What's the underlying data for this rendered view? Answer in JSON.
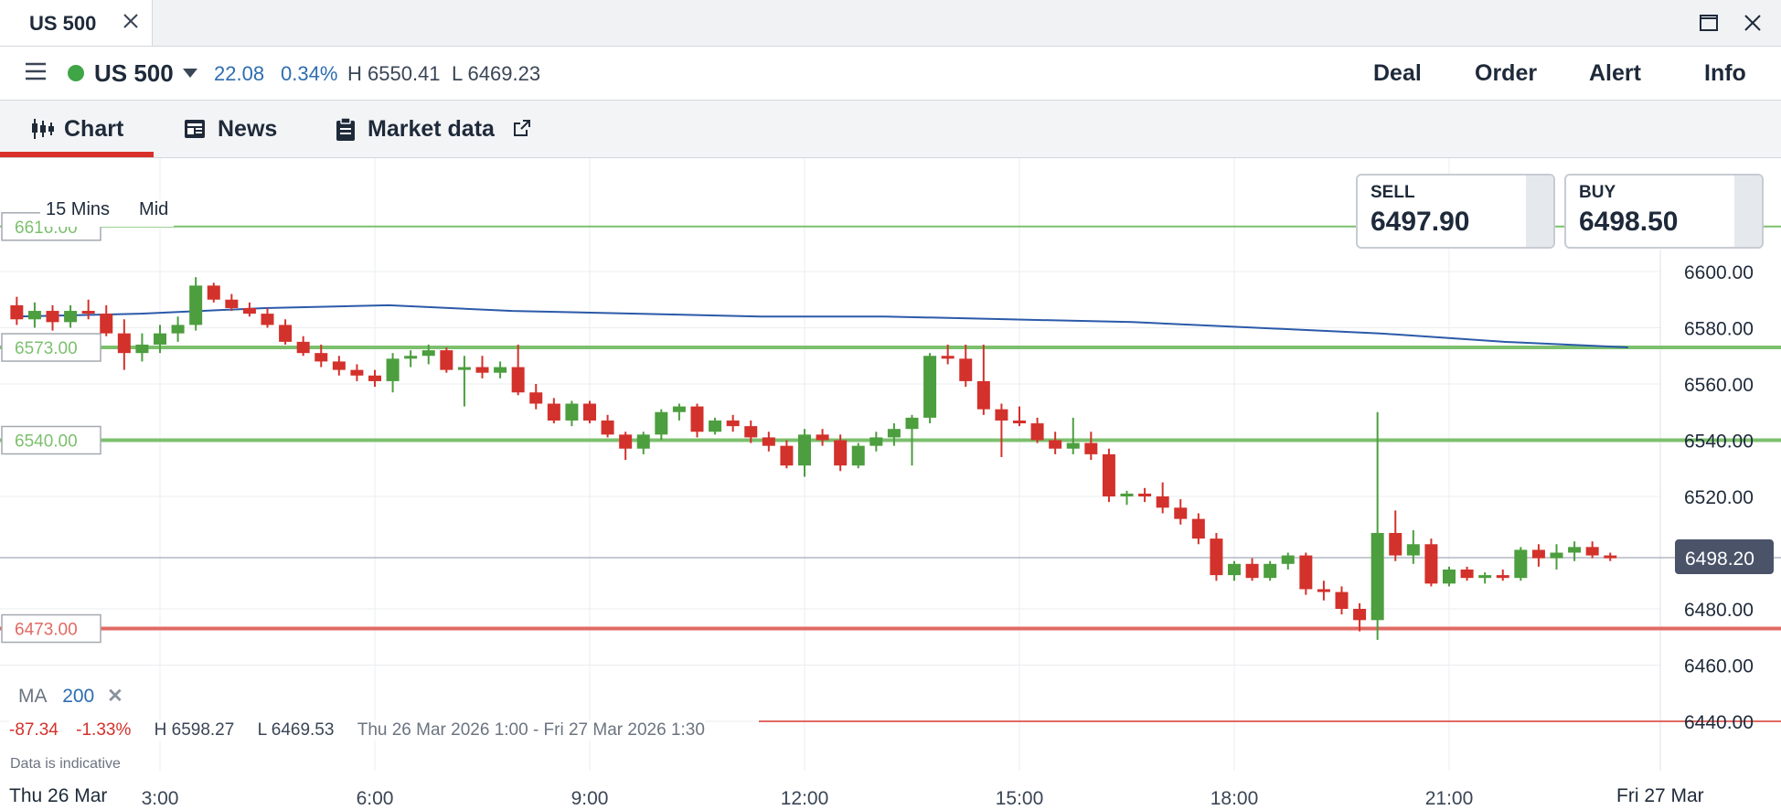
{
  "window": {
    "tab_title": "US 500"
  },
  "instrument": {
    "name": "US 500",
    "change": "22.08",
    "change_pct": "0.34%",
    "high": "H 6550.41",
    "low": "L 6469.23",
    "status_color": "#3fa546"
  },
  "actions": [
    "Deal",
    "Order",
    "Alert",
    "Info"
  ],
  "subtabs": [
    {
      "label": "Chart",
      "icon": "candlestick-icon",
      "active": true
    },
    {
      "label": "News",
      "icon": "newspaper-icon",
      "active": false
    },
    {
      "label": "Market data",
      "icon": "clipboard-icon",
      "active": false
    }
  ],
  "chart": {
    "timeframe": "15 Mins",
    "price_type": "Mid",
    "sell": {
      "label": "SELL",
      "price": "6497.90"
    },
    "buy": {
      "label": "BUY",
      "price": "6498.50"
    },
    "ma": {
      "label": "MA",
      "period": "200",
      "color": "#2b5aa8"
    },
    "stats": {
      "change": "-87.34",
      "change_pct": "-1.33%",
      "high": "H 6598.27",
      "low": "L 6469.53",
      "range": "Thu 26 Mar 2026 1:00 - Fri 27 Mar 2026 1:30"
    },
    "disclaimer": "Data is indicative",
    "start_date": "Thu 26 Mar",
    "end_date": "Fri 27 Mar",
    "current_price": "6498.20",
    "colors": {
      "up": "#4c9e3e",
      "down": "#d3312b",
      "green_line": "#7cc06e",
      "red_line": "#e06a63"
    }
  },
  "chart_data": {
    "type": "candlestick",
    "y_ticks": [
      6600,
      6580,
      6560,
      6540,
      6520,
      6480,
      6460,
      6440
    ],
    "y_tick_labels": [
      "6600.00",
      "6580.00",
      "6560.00",
      "6540.00",
      "6520.00",
      "6480.00",
      "6460.00",
      "6440.00"
    ],
    "ylim": [
      6424,
      6645
    ],
    "x_ticks": [
      "3:00",
      "6:00",
      "9:00",
      "12:00",
      "15:00",
      "18:00",
      "21:00"
    ],
    "level_lines": [
      {
        "price": 6573.0,
        "label": "6573.00",
        "color": "green"
      },
      {
        "price": 6540.0,
        "label": "6540.00",
        "color": "green"
      },
      {
        "price": 6473.0,
        "label": "6473.00",
        "color": "red"
      },
      {
        "price": 6440.0,
        "label": "6440.00",
        "color": "red"
      },
      {
        "price": 6616.0,
        "label": "6616.00",
        "color": "green"
      }
    ],
    "current_price": 6498.2,
    "candles": [
      {
        "t": "1:00",
        "o": 6588,
        "h": 6591,
        "l": 6581,
        "c": 6583
      },
      {
        "t": "1:15",
        "o": 6583,
        "h": 6589,
        "l": 6580,
        "c": 6586
      },
      {
        "t": "1:30",
        "o": 6586,
        "h": 6588,
        "l": 6579,
        "c": 6582
      },
      {
        "t": "1:45",
        "o": 6582,
        "h": 6588,
        "l": 6580,
        "c": 6586
      },
      {
        "t": "2:00",
        "o": 6586,
        "h": 6590,
        "l": 6583,
        "c": 6585
      },
      {
        "t": "2:15",
        "o": 6585,
        "h": 6588,
        "l": 6577,
        "c": 6578
      },
      {
        "t": "2:30",
        "o": 6578,
        "h": 6583,
        "l": 6565,
        "c": 6571
      },
      {
        "t": "2:45",
        "o": 6571,
        "h": 6578,
        "l": 6568,
        "c": 6574
      },
      {
        "t": "3:00",
        "o": 6574,
        "h": 6581,
        "l": 6571,
        "c": 6578
      },
      {
        "t": "3:15",
        "o": 6578,
        "h": 6584,
        "l": 6575,
        "c": 6581
      },
      {
        "t": "3:30",
        "o": 6581,
        "h": 6598,
        "l": 6579,
        "c": 6595
      },
      {
        "t": "3:45",
        "o": 6595,
        "h": 6596,
        "l": 6589,
        "c": 6590
      },
      {
        "t": "4:00",
        "o": 6590,
        "h": 6592,
        "l": 6586,
        "c": 6587
      },
      {
        "t": "4:15",
        "o": 6587,
        "h": 6589,
        "l": 6584,
        "c": 6585
      },
      {
        "t": "4:30",
        "o": 6585,
        "h": 6587,
        "l": 6580,
        "c": 6581
      },
      {
        "t": "4:45",
        "o": 6581,
        "h": 6583,
        "l": 6574,
        "c": 6575
      },
      {
        "t": "5:00",
        "o": 6575,
        "h": 6577,
        "l": 6570,
        "c": 6571
      },
      {
        "t": "5:15",
        "o": 6571,
        "h": 6574,
        "l": 6566,
        "c": 6568
      },
      {
        "t": "5:30",
        "o": 6568,
        "h": 6570,
        "l": 6563,
        "c": 6565
      },
      {
        "t": "5:45",
        "o": 6565,
        "h": 6567,
        "l": 6561,
        "c": 6563
      },
      {
        "t": "6:00",
        "o": 6563,
        "h": 6565,
        "l": 6559,
        "c": 6561
      },
      {
        "t": "6:15",
        "o": 6561,
        "h": 6571,
        "l": 6557,
        "c": 6569
      },
      {
        "t": "6:30",
        "o": 6569,
        "h": 6572,
        "l": 6566,
        "c": 6570
      },
      {
        "t": "6:45",
        "o": 6570,
        "h": 6574,
        "l": 6567,
        "c": 6572
      },
      {
        "t": "7:00",
        "o": 6572,
        "h": 6573,
        "l": 6564,
        "c": 6565
      },
      {
        "t": "7:15",
        "o": 6565,
        "h": 6570,
        "l": 6552,
        "c": 6566
      },
      {
        "t": "7:30",
        "o": 6566,
        "h": 6570,
        "l": 6562,
        "c": 6564
      },
      {
        "t": "7:45",
        "o": 6564,
        "h": 6568,
        "l": 6562,
        "c": 6566
      },
      {
        "t": "8:00",
        "o": 6566,
        "h": 6574,
        "l": 6556,
        "c": 6557
      },
      {
        "t": "8:15",
        "o": 6557,
        "h": 6560,
        "l": 6551,
        "c": 6553
      },
      {
        "t": "8:30",
        "o": 6553,
        "h": 6555,
        "l": 6546,
        "c": 6547
      },
      {
        "t": "8:45",
        "o": 6547,
        "h": 6554,
        "l": 6545,
        "c": 6553
      },
      {
        "t": "9:00",
        "o": 6553,
        "h": 6554,
        "l": 6546,
        "c": 6547
      },
      {
        "t": "9:15",
        "o": 6547,
        "h": 6549,
        "l": 6541,
        "c": 6542
      },
      {
        "t": "9:30",
        "o": 6542,
        "h": 6543,
        "l": 6533,
        "c": 6537
      },
      {
        "t": "9:45",
        "o": 6537,
        "h": 6543,
        "l": 6535,
        "c": 6542
      },
      {
        "t": "10:00",
        "o": 6542,
        "h": 6551,
        "l": 6540,
        "c": 6550
      },
      {
        "t": "10:15",
        "o": 6550,
        "h": 6553,
        "l": 6547,
        "c": 6552
      },
      {
        "t": "10:30",
        "o": 6552,
        "h": 6553,
        "l": 6541,
        "c": 6543
      },
      {
        "t": "10:45",
        "o": 6543,
        "h": 6548,
        "l": 6542,
        "c": 6547
      },
      {
        "t": "11:00",
        "o": 6547,
        "h": 6549,
        "l": 6543,
        "c": 6545
      },
      {
        "t": "11:15",
        "o": 6545,
        "h": 6547,
        "l": 6539,
        "c": 6541
      },
      {
        "t": "11:30",
        "o": 6541,
        "h": 6543,
        "l": 6536,
        "c": 6538
      },
      {
        "t": "11:45",
        "o": 6538,
        "h": 6540,
        "l": 6530,
        "c": 6531
      },
      {
        "t": "12:00",
        "o": 6531,
        "h": 6544,
        "l": 6527,
        "c": 6542
      },
      {
        "t": "12:15",
        "o": 6542,
        "h": 6544,
        "l": 6538,
        "c": 6540
      },
      {
        "t": "12:30",
        "o": 6540,
        "h": 6542,
        "l": 6529,
        "c": 6531
      },
      {
        "t": "12:45",
        "o": 6531,
        "h": 6539,
        "l": 6530,
        "c": 6538
      },
      {
        "t": "13:00",
        "o": 6538,
        "h": 6543,
        "l": 6536,
        "c": 6541
      },
      {
        "t": "13:15",
        "o": 6541,
        "h": 6546,
        "l": 6538,
        "c": 6544
      },
      {
        "t": "13:30",
        "o": 6544,
        "h": 6549,
        "l": 6531,
        "c": 6548
      },
      {
        "t": "13:45",
        "o": 6548,
        "h": 6571,
        "l": 6546,
        "c": 6570
      },
      {
        "t": "14:00",
        "o": 6570,
        "h": 6574,
        "l": 6567,
        "c": 6569
      },
      {
        "t": "14:15",
        "o": 6569,
        "h": 6574,
        "l": 6559,
        "c": 6561
      },
      {
        "t": "14:30",
        "o": 6561,
        "h": 6574,
        "l": 6549,
        "c": 6551
      },
      {
        "t": "14:45",
        "o": 6551,
        "h": 6553,
        "l": 6534,
        "c": 6547
      },
      {
        "t": "15:00",
        "o": 6547,
        "h": 6552,
        "l": 6545,
        "c": 6546
      },
      {
        "t": "15:15",
        "o": 6546,
        "h": 6548,
        "l": 6539,
        "c": 6540
      },
      {
        "t": "15:30",
        "o": 6540,
        "h": 6543,
        "l": 6535,
        "c": 6537
      },
      {
        "t": "15:45",
        "o": 6537,
        "h": 6548,
        "l": 6535,
        "c": 6539
      },
      {
        "t": "16:00",
        "o": 6539,
        "h": 6543,
        "l": 6533,
        "c": 6535
      },
      {
        "t": "16:15",
        "o": 6535,
        "h": 6537,
        "l": 6518,
        "c": 6520
      },
      {
        "t": "16:30",
        "o": 6520,
        "h": 6522,
        "l": 6517,
        "c": 6521
      },
      {
        "t": "16:45",
        "o": 6521,
        "h": 6523,
        "l": 6518,
        "c": 6520
      },
      {
        "t": "17:00",
        "o": 6520,
        "h": 6525,
        "l": 6514,
        "c": 6516
      },
      {
        "t": "17:15",
        "o": 6516,
        "h": 6519,
        "l": 6510,
        "c": 6512
      },
      {
        "t": "17:30",
        "o": 6512,
        "h": 6514,
        "l": 6503,
        "c": 6505
      },
      {
        "t": "17:45",
        "o": 6505,
        "h": 6507,
        "l": 6490,
        "c": 6492
      },
      {
        "t": "18:00",
        "o": 6492,
        "h": 6497,
        "l": 6490,
        "c": 6496
      },
      {
        "t": "18:15",
        "o": 6496,
        "h": 6498,
        "l": 6490,
        "c": 6491
      },
      {
        "t": "18:30",
        "o": 6491,
        "h": 6497,
        "l": 6490,
        "c": 6496
      },
      {
        "t": "18:45",
        "o": 6496,
        "h": 6500,
        "l": 6494,
        "c": 6499
      },
      {
        "t": "19:00",
        "o": 6499,
        "h": 6500,
        "l": 6485,
        "c": 6487
      },
      {
        "t": "19:15",
        "o": 6487,
        "h": 6490,
        "l": 6483,
        "c": 6486
      },
      {
        "t": "19:30",
        "o": 6486,
        "h": 6488,
        "l": 6478,
        "c": 6480
      },
      {
        "t": "19:45",
        "o": 6480,
        "h": 6482,
        "l": 6472,
        "c": 6476
      },
      {
        "t": "20:00",
        "o": 6476,
        "h": 6550,
        "l": 6469,
        "c": 6507
      },
      {
        "t": "20:15",
        "o": 6507,
        "h": 6515,
        "l": 6497,
        "c": 6499
      },
      {
        "t": "20:30",
        "o": 6499,
        "h": 6508,
        "l": 6496,
        "c": 6503
      },
      {
        "t": "20:45",
        "o": 6503,
        "h": 6505,
        "l": 6488,
        "c": 6489
      },
      {
        "t": "21:00",
        "o": 6489,
        "h": 6495,
        "l": 6488,
        "c": 6494
      },
      {
        "t": "21:15",
        "o": 6494,
        "h": 6495,
        "l": 6490,
        "c": 6491
      },
      {
        "t": "21:30",
        "o": 6491,
        "h": 6493,
        "l": 6489,
        "c": 6492
      },
      {
        "t": "21:45",
        "o": 6492,
        "h": 6494,
        "l": 6490,
        "c": 6491
      },
      {
        "t": "22:00",
        "o": 6491,
        "h": 6502,
        "l": 6490,
        "c": 6501
      },
      {
        "t": "22:15",
        "o": 6501,
        "h": 6503,
        "l": 6495,
        "c": 6498
      },
      {
        "t": "22:30",
        "o": 6498,
        "h": 6503,
        "l": 6494,
        "c": 6500
      },
      {
        "t": "22:45",
        "o": 6500,
        "h": 6504,
        "l": 6497,
        "c": 6502
      },
      {
        "t": "23:00",
        "o": 6502,
        "h": 6504,
        "l": 6498,
        "c": 6499
      },
      {
        "t": "23:15",
        "o": 6499,
        "h": 6500,
        "l": 6497,
        "c": 6498
      }
    ],
    "ma200": [
      6584,
      6585,
      6587,
      6588,
      6586,
      6585,
      6584,
      6584,
      6583,
      6582,
      6580,
      6578,
      6575,
      6573
    ]
  }
}
